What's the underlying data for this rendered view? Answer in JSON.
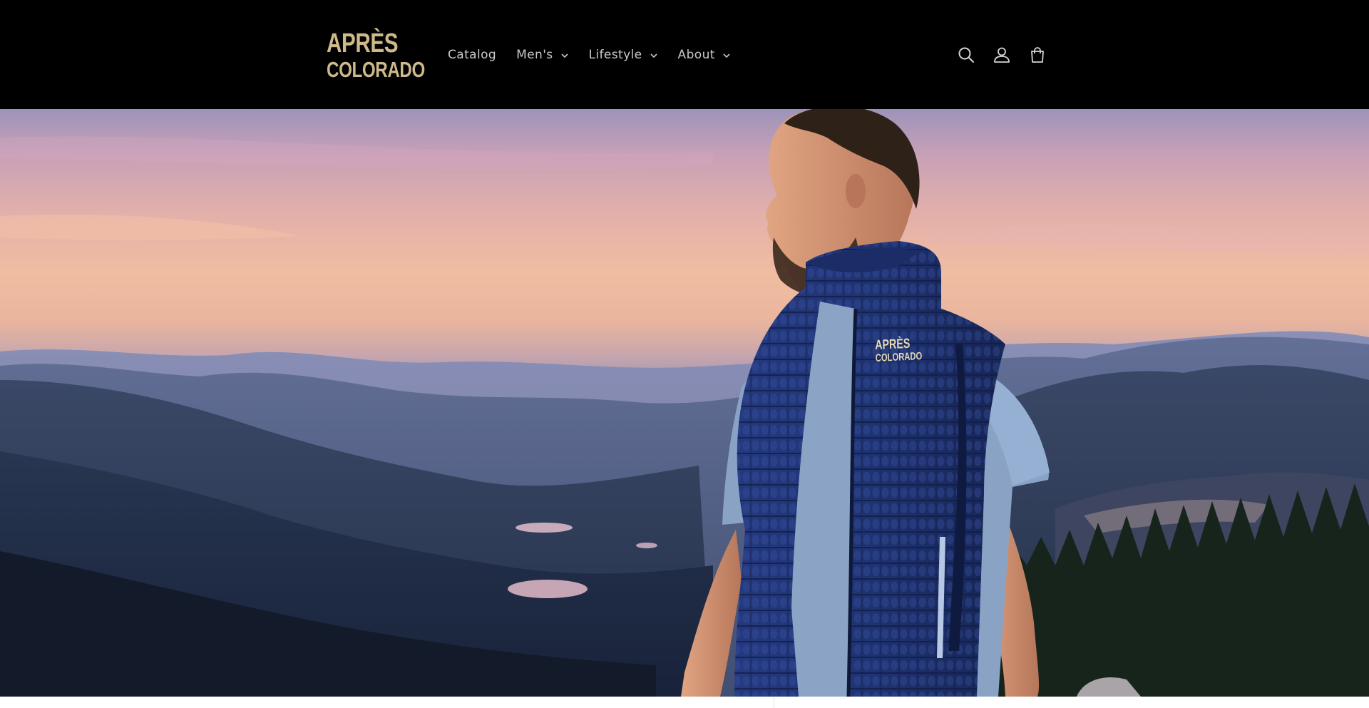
{
  "header": {
    "logo": {
      "line1": "APRÈS",
      "line2": "COLORADO"
    },
    "nav": [
      {
        "label": "Catalog",
        "has_dropdown": false
      },
      {
        "label": "Men's",
        "has_dropdown": true
      },
      {
        "label": "Lifestyle",
        "has_dropdown": true
      },
      {
        "label": "About",
        "has_dropdown": true
      }
    ],
    "icons": [
      "search-icon",
      "account-icon",
      "cart-icon"
    ]
  },
  "hero": {
    "vest_logo": {
      "line1": "APRÈS",
      "line2": "COLORADO"
    }
  },
  "colors": {
    "header_bg": "#000000",
    "logo_gold": "#cdb98a",
    "nav_text": "#c9c9c9",
    "vest_navy": "#1f3272"
  }
}
